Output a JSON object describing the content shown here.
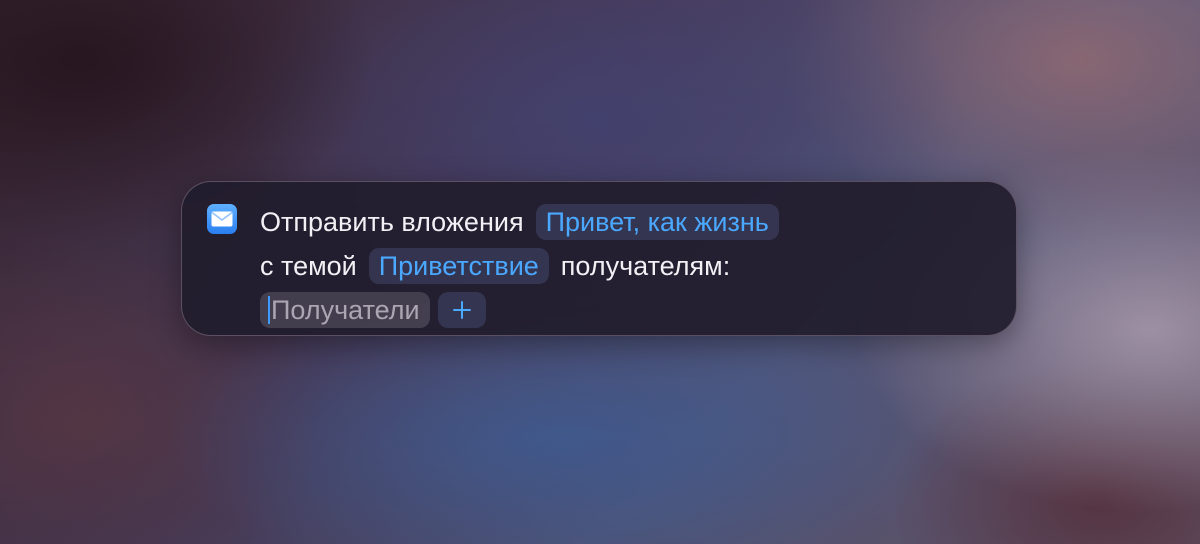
{
  "action": {
    "app_icon": "mail-envelope-icon",
    "line1": {
      "text1": "Отправить вложения",
      "attachment_token": "Привет, как жизнь"
    },
    "line2": {
      "text1": "с темой",
      "subject_token": "Приветствие",
      "text2": "получателям:"
    },
    "line3": {
      "recipients_placeholder": "Получатели",
      "add_icon": "plus-icon"
    }
  },
  "colors": {
    "accent": "#4aa8ff",
    "card_background": "#211c2c",
    "text": "#f2f0f4"
  }
}
